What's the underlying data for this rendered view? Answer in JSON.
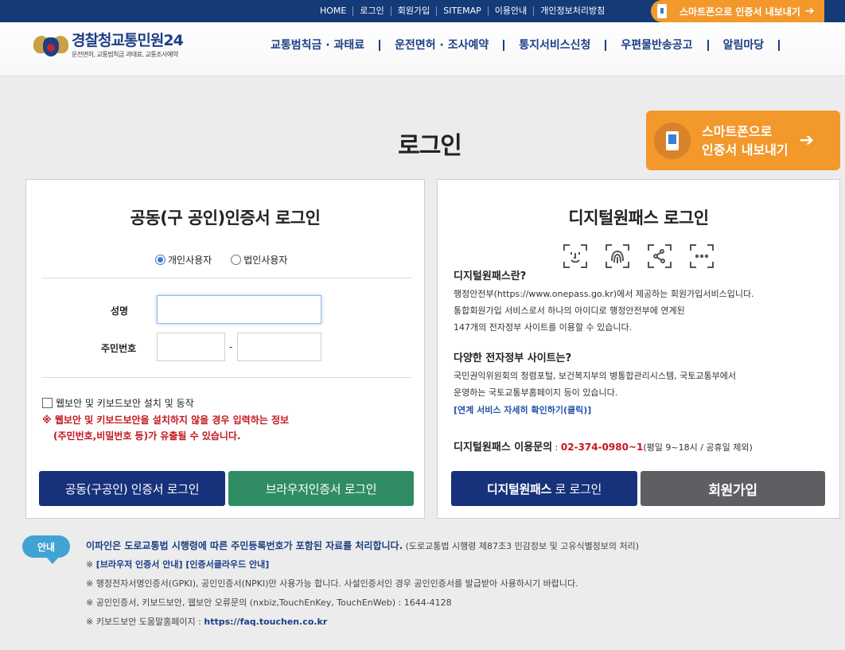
{
  "topbar": {
    "links": [
      "HOME",
      "로그인",
      "회원가입",
      "SITEMAP",
      "이용안내",
      "개인정보처리방침"
    ],
    "smart_label": "스마트폰으로 인증서 내보내기"
  },
  "header": {
    "logo_main": "경찰청교통민원24",
    "logo_sub": "운전면허, 교통범칙금 과태료, 교통조사예약",
    "nav": [
      "교통범칙금 · 과태료",
      "운전면허 · 조사예약",
      "통지서비스신청",
      "우편물반송공고",
      "알림마당"
    ]
  },
  "page": {
    "title": "로그인",
    "smart_big_line1": "스마트폰으로",
    "smart_big_line2": "인증서 내보내기"
  },
  "cert_login": {
    "title": "공동(구 공인)인증서 로그인",
    "radio_personal": "개인사용자",
    "radio_corporate": "법인사용자",
    "name_label": "성명",
    "rrn_label": "주민번호",
    "dash": "-",
    "security_check": "웹보안 및 키보드보안 설치 및 동작",
    "warning_line1": "※ 웹보안 및 키보드보안을 설치하지 않을 경우 입력하는 정보",
    "warning_line2": "(주민번호,비밀번호 등)가 유출될 수 있습니다.",
    "btn_cert": "공동(구공인) 인증서 로그인",
    "btn_browser": "브라우저인증서 로그인"
  },
  "digital_login": {
    "title": "디지털원패스 로그인",
    "icons": [
      "face-id-icon",
      "fingerprint-icon",
      "pattern-icon",
      "pin-icon"
    ],
    "what_title": "디지털원패스란?",
    "what_p1": "행정안전부(https://www.onepass.go.kr)에서 제공하는 회원가입서비스입니다.",
    "what_p2": "통합회원가입 서비스로서 하나의 아이디로 행정안전부에 연계된",
    "what_p3": "147개의 전자정부 사이트를 이용할 수 있습니다.",
    "sites_title": "다양한 전자정부 사이트는?",
    "sites_p1": "국민권익위원회의 청렴포털, 보건복지부의 병통합관리시스템, 국토교통부에서",
    "sites_p2": "운영하는 국토교통부홈페이지 등이 있습니다.",
    "link": "[연계 서비스 자세히 확인하기(클릭)]",
    "contact_label": "디지털원패스 이용문의",
    "contact_sep": " : ",
    "contact_phone": "02-374-0980~1",
    "contact_hours": "(평일 9~18시 / 공휴일 제외)",
    "btn_login_bold": "디지털원패스",
    "btn_login_rest": "로 로그인",
    "btn_join": "회원가입"
  },
  "notice": {
    "badge": "안내",
    "line1_bold": "이파인은 도로교통법 시행령에 따른 주민등록번호가 포함된 자료를 처리합니다.",
    "line1_rest": " (도로교통법 시행령 제87조3 민감정보 및 고유식별정보의 처리)",
    "line2_prefix": "※ ",
    "line2_link1": "[브라우저 인증서 안내]",
    "line2_link2": " [인증서클라우드 안내]",
    "line3": "※ 행정전자서명인증서(GPKI), 공인인증서(NPKI)만 사용가능 합니다. 사설인증서인 경우 공인인증서를 발급받아 사용하시기 바랍니다.",
    "line4": "※ 공인인증서, 키보드보안, 웹보안 오류문의 (nxbiz,TouchEnKey, TouchEnWeb) : 1644-4128",
    "line5_prefix": "※ 키보드보안 도움말홈페이지 : ",
    "line5_link": "https://faq.touchen.co.kr"
  }
}
